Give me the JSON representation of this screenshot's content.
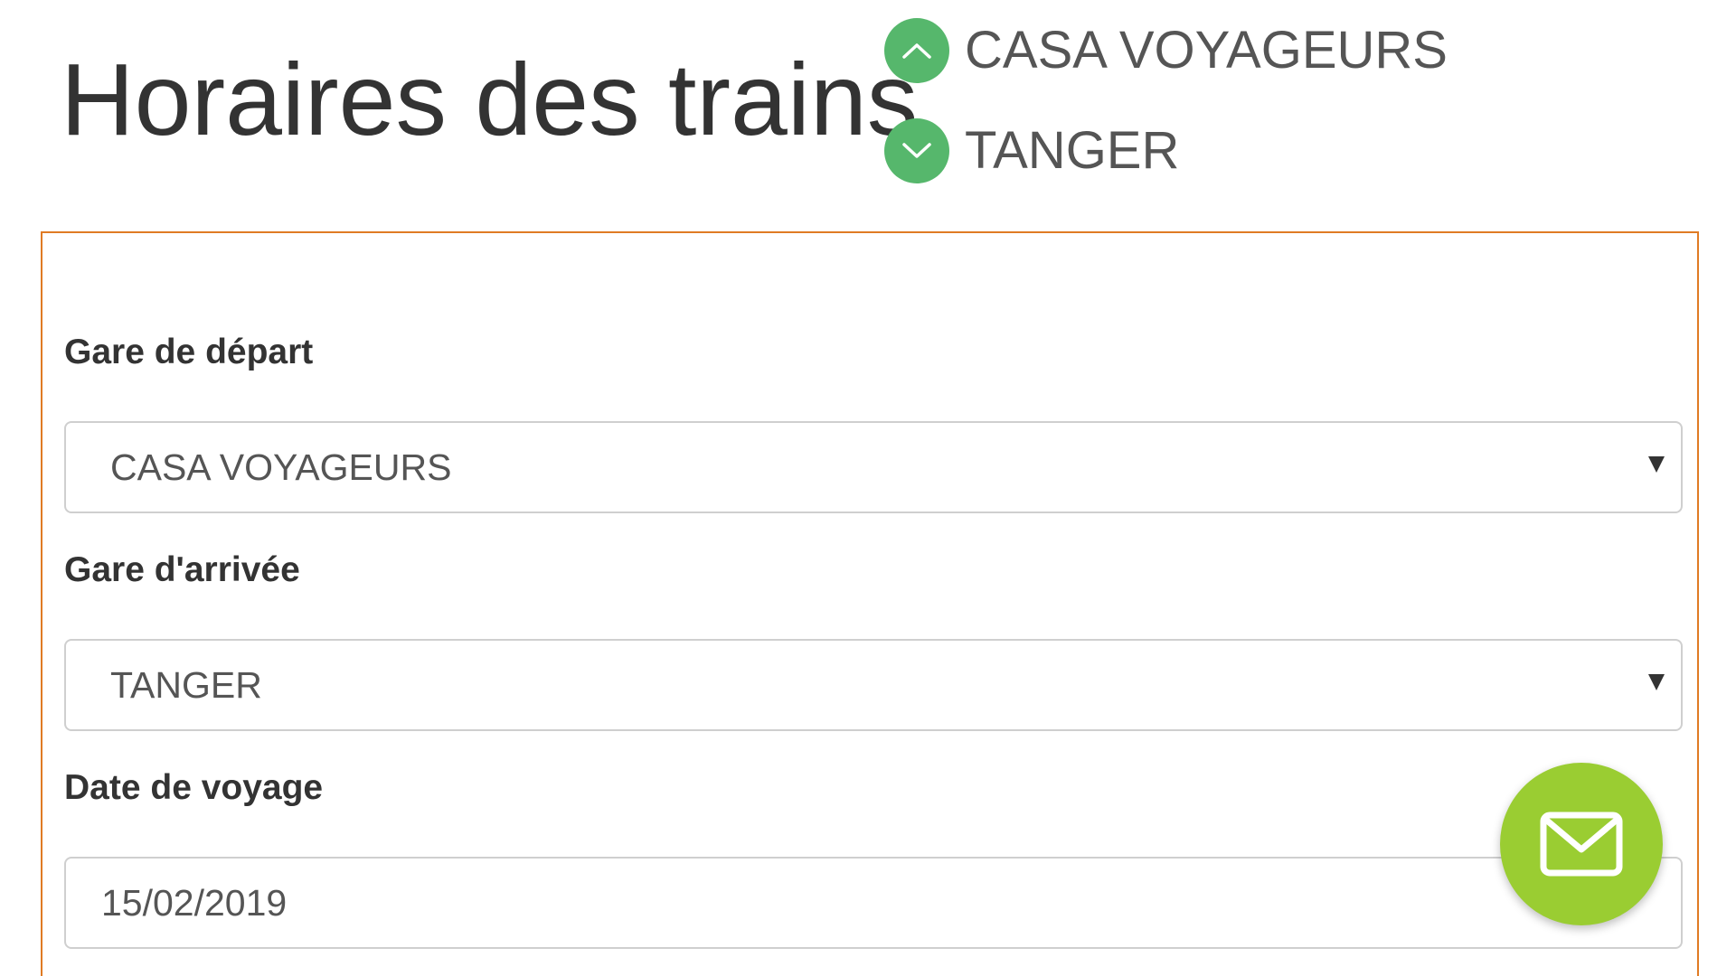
{
  "header": {
    "title": "Horaires des trains",
    "route_from": "CASA VOYAGEURS",
    "route_to": "TANGER",
    "route_from_icon": "chevron-up-icon",
    "route_to_icon": "chevron-down-icon"
  },
  "form": {
    "departure_label": "Gare de départ",
    "departure_value": "CASA VOYAGEURS",
    "arrival_label": "Gare d'arrivée",
    "arrival_value": "TANGER",
    "date_label": "Date de voyage",
    "date_value": "15/02/2019"
  },
  "contact_button": {
    "icon": "envelope-icon"
  },
  "colors": {
    "panel_border": "#e07b24",
    "route_circle": "#56b76c",
    "contact_button": "#9acd32",
    "title_text": "#333333"
  }
}
